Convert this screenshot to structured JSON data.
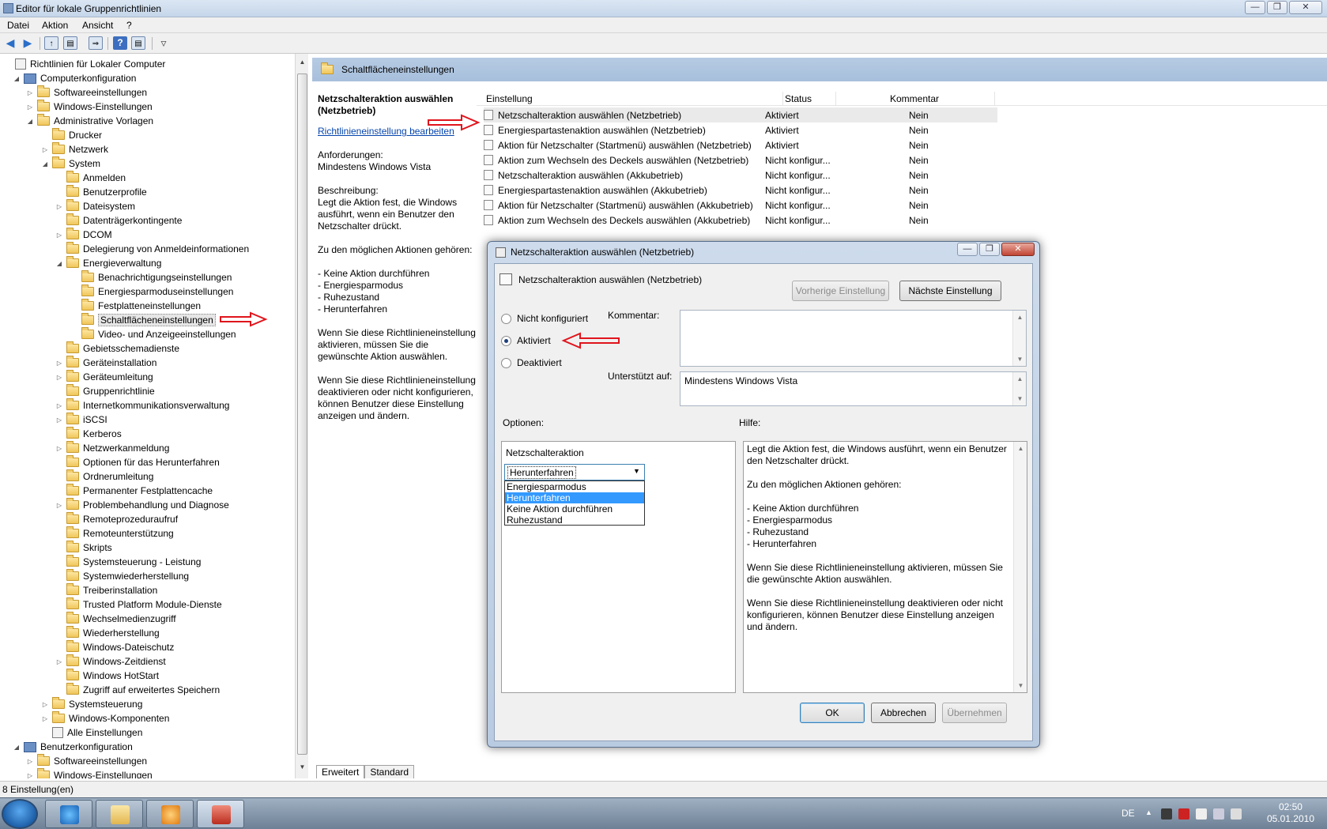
{
  "window": {
    "title": "Editor für lokale Gruppenrichtlinien"
  },
  "menu": [
    "Datei",
    "Aktion",
    "Ansicht",
    "?"
  ],
  "tree": {
    "items": [
      {
        "label": "Richtlinien für Lokaler Computer",
        "level": 0,
        "icon": "policy-icon",
        "exp": ""
      },
      {
        "label": "Computerkonfiguration",
        "level": 1,
        "icon": "computer-icon",
        "exp": "open"
      },
      {
        "label": "Softwareeinstellungen",
        "level": 2,
        "icon": "folder-icon",
        "exp": "closed"
      },
      {
        "label": "Windows-Einstellungen",
        "level": 2,
        "icon": "folder-icon",
        "exp": "closed"
      },
      {
        "label": "Administrative Vorlagen",
        "level": 2,
        "icon": "folder-icon",
        "exp": "open"
      },
      {
        "label": "Drucker",
        "level": 3,
        "icon": "folder-icon",
        "exp": ""
      },
      {
        "label": "Netzwerk",
        "level": 3,
        "icon": "folder-icon",
        "exp": "closed"
      },
      {
        "label": "System",
        "level": 3,
        "icon": "folder-icon",
        "exp": "open"
      },
      {
        "label": "Anmelden",
        "level": 4,
        "icon": "folder-icon",
        "exp": ""
      },
      {
        "label": "Benutzerprofile",
        "level": 4,
        "icon": "folder-icon",
        "exp": ""
      },
      {
        "label": "Dateisystem",
        "level": 4,
        "icon": "folder-icon",
        "exp": "closed"
      },
      {
        "label": "Datenträgerkontingente",
        "level": 4,
        "icon": "folder-icon",
        "exp": ""
      },
      {
        "label": "DCOM",
        "level": 4,
        "icon": "folder-icon",
        "exp": "closed"
      },
      {
        "label": "Delegierung von Anmeldeinformationen",
        "level": 4,
        "icon": "folder-icon",
        "exp": ""
      },
      {
        "label": "Energieverwaltung",
        "level": 4,
        "icon": "folder-icon",
        "exp": "open"
      },
      {
        "label": "Benachrichtigungseinstellungen",
        "level": 5,
        "icon": "folder-icon",
        "exp": ""
      },
      {
        "label": "Energiesparmoduseinstellungen",
        "level": 5,
        "icon": "folder-icon",
        "exp": ""
      },
      {
        "label": "Festplatteneinstellungen",
        "level": 5,
        "icon": "folder-icon",
        "exp": ""
      },
      {
        "label": "Schaltflächeneinstellungen",
        "level": 5,
        "icon": "folder-icon",
        "exp": "",
        "selected": true
      },
      {
        "label": "Video- und Anzeigeeinstellungen",
        "level": 5,
        "icon": "folder-icon",
        "exp": ""
      },
      {
        "label": "Gebietsschemadienste",
        "level": 4,
        "icon": "folder-icon",
        "exp": ""
      },
      {
        "label": "Geräteinstallation",
        "level": 4,
        "icon": "folder-icon",
        "exp": "closed"
      },
      {
        "label": "Geräteumleitung",
        "level": 4,
        "icon": "folder-icon",
        "exp": "closed"
      },
      {
        "label": "Gruppenrichtlinie",
        "level": 4,
        "icon": "folder-icon",
        "exp": ""
      },
      {
        "label": "Internetkommunikationsverwaltung",
        "level": 4,
        "icon": "folder-icon",
        "exp": "closed"
      },
      {
        "label": "iSCSI",
        "level": 4,
        "icon": "folder-icon",
        "exp": "closed"
      },
      {
        "label": "Kerberos",
        "level": 4,
        "icon": "folder-icon",
        "exp": ""
      },
      {
        "label": "Netzwerkanmeldung",
        "level": 4,
        "icon": "folder-icon",
        "exp": "closed"
      },
      {
        "label": "Optionen für das Herunterfahren",
        "level": 4,
        "icon": "folder-icon",
        "exp": ""
      },
      {
        "label": "Ordnerumleitung",
        "level": 4,
        "icon": "folder-icon",
        "exp": ""
      },
      {
        "label": "Permanenter Festplattencache",
        "level": 4,
        "icon": "folder-icon",
        "exp": ""
      },
      {
        "label": "Problembehandlung und Diagnose",
        "level": 4,
        "icon": "folder-icon",
        "exp": "closed"
      },
      {
        "label": "Remoteprozeduraufruf",
        "level": 4,
        "icon": "folder-icon",
        "exp": ""
      },
      {
        "label": "Remoteunterstützung",
        "level": 4,
        "icon": "folder-icon",
        "exp": ""
      },
      {
        "label": "Skripts",
        "level": 4,
        "icon": "folder-icon",
        "exp": ""
      },
      {
        "label": "Systemsteuerung - Leistung",
        "level": 4,
        "icon": "folder-icon",
        "exp": ""
      },
      {
        "label": "Systemwiederherstellung",
        "level": 4,
        "icon": "folder-icon",
        "exp": ""
      },
      {
        "label": "Treiberinstallation",
        "level": 4,
        "icon": "folder-icon",
        "exp": ""
      },
      {
        "label": "Trusted Platform Module-Dienste",
        "level": 4,
        "icon": "folder-icon",
        "exp": ""
      },
      {
        "label": "Wechselmedienzugriff",
        "level": 4,
        "icon": "folder-icon",
        "exp": ""
      },
      {
        "label": "Wiederherstellung",
        "level": 4,
        "icon": "folder-icon",
        "exp": ""
      },
      {
        "label": "Windows-Dateischutz",
        "level": 4,
        "icon": "folder-icon",
        "exp": ""
      },
      {
        "label": "Windows-Zeitdienst",
        "level": 4,
        "icon": "folder-icon",
        "exp": "closed"
      },
      {
        "label": "Windows HotStart",
        "level": 4,
        "icon": "folder-icon",
        "exp": ""
      },
      {
        "label": "Zugriff auf erweitertes Speichern",
        "level": 4,
        "icon": "folder-icon",
        "exp": ""
      },
      {
        "label": "Systemsteuerung",
        "level": 3,
        "icon": "folder-icon",
        "exp": "closed"
      },
      {
        "label": "Windows-Komponenten",
        "level": 3,
        "icon": "folder-icon",
        "exp": "closed"
      },
      {
        "label": "Alle Einstellungen",
        "level": 3,
        "icon": "policy-icon",
        "exp": ""
      },
      {
        "label": "Benutzerkonfiguration",
        "level": 1,
        "icon": "user-icon",
        "exp": "open"
      },
      {
        "label": "Softwareeinstellungen",
        "level": 2,
        "icon": "folder-icon",
        "exp": "closed"
      },
      {
        "label": "Windows-Einstellungen",
        "level": 2,
        "icon": "folder-icon",
        "exp": "closed"
      }
    ]
  },
  "right_pane": {
    "header": "Schaltflächeneinstellungen",
    "description": {
      "title": "Netzschalteraktion auswählen (Netzbetrieb)",
      "link": "Richtlinieneinstellung bearbeiten",
      "requirements_label": "Anforderungen:",
      "requirements_value": "Mindestens Windows Vista",
      "description_label": "Beschreibung:",
      "description_text": "Legt die Aktion fest, die Windows ausführt, wenn ein Benutzer den Netzschalter drückt.",
      "actions_label": "Zu den möglichen Aktionen gehören:",
      "actions": [
        "- Keine Aktion durchführen",
        "- Energiesparmodus",
        "- Ruhezustand",
        "- Herunterfahren"
      ],
      "enable_text": "Wenn Sie diese Richtlinieneinstellung aktivieren, müssen Sie die gewünschte Aktion auswählen.",
      "disable_text": "Wenn Sie diese Richtlinieneinstellung deaktivieren oder nicht konfigurieren, können Benutzer diese Einstellung anzeigen und ändern."
    },
    "columns": [
      "Einstellung",
      "Status",
      "Kommentar"
    ],
    "rows": [
      {
        "name": "Netzschalteraktion auswählen (Netzbetrieb)",
        "status": "Aktiviert",
        "comment": "Nein"
      },
      {
        "name": "Energiespartastenaktion auswählen (Netzbetrieb)",
        "status": "Aktiviert",
        "comment": "Nein"
      },
      {
        "name": "Aktion für Netzschalter (Startmenü) auswählen (Netzbetrieb)",
        "status": "Aktiviert",
        "comment": "Nein"
      },
      {
        "name": "Aktion zum Wechseln des Deckels auswählen (Netzbetrieb)",
        "status": "Nicht konfigur...",
        "comment": "Nein"
      },
      {
        "name": "Netzschalteraktion auswählen (Akkubetrieb)",
        "status": "Nicht konfigur...",
        "comment": "Nein"
      },
      {
        "name": "Energiespartastenaktion auswählen (Akkubetrieb)",
        "status": "Nicht konfigur...",
        "comment": "Nein"
      },
      {
        "name": "Aktion für Netzschalter (Startmenü) auswählen (Akkubetrieb)",
        "status": "Nicht konfigur...",
        "comment": "Nein"
      },
      {
        "name": "Aktion zum Wechseln des Deckels auswählen (Akkubetrieb)",
        "status": "Nicht konfigur...",
        "comment": "Nein"
      }
    ],
    "tabs": [
      "Erweitert",
      "Standard"
    ]
  },
  "status_bar": "8 Einstellung(en)",
  "dialog": {
    "title": "Netzschalteraktion auswählen (Netzbetrieb)",
    "subtitle": "Netzschalteraktion auswählen (Netzbetrieb)",
    "prev_button": "Vorherige Einstellung",
    "next_button": "Nächste Einstellung",
    "radio_not_configured": "Nicht konfiguriert",
    "radio_enabled": "Aktiviert",
    "radio_disabled": "Deaktiviert",
    "selected_radio": "Aktiviert",
    "comment_label": "Kommentar:",
    "comment_value": "",
    "supported_label": "Unterstützt auf:",
    "supported_value": "Mindestens Windows Vista",
    "options_label": "Optionen:",
    "help_label": "Hilfe:",
    "option_field_label": "Netzschalteraktion",
    "select_value": "Herunterfahren",
    "dropdown_options": [
      "Energiesparmodus",
      "Herunterfahren",
      "Keine Aktion durchführen",
      "Ruhezustand"
    ],
    "highlighted_option": "Herunterfahren",
    "help_paragraphs": [
      "Legt die Aktion fest, die Windows ausführt, wenn ein Benutzer den Netzschalter drückt.",
      "Zu den möglichen Aktionen gehören:",
      "- Keine Aktion durchführen\n- Energiesparmodus\n- Ruhezustand\n- Herunterfahren",
      "Wenn Sie diese Richtlinieneinstellung aktivieren, müssen Sie die gewünschte Aktion auswählen.",
      "Wenn Sie diese Richtlinieneinstellung deaktivieren oder nicht konfigurieren, können Benutzer diese Einstellung anzeigen und ändern."
    ],
    "ok_button": "OK",
    "cancel_button": "Abbrechen",
    "apply_button": "Übernehmen"
  },
  "taskbar": {
    "language": "DE",
    "time": "02:50",
    "date": "05.01.2010"
  },
  "colors": {
    "annotation_arrow": "#e0141c",
    "header_blue": "#a7bfdc",
    "highlight": "#3399ff"
  }
}
